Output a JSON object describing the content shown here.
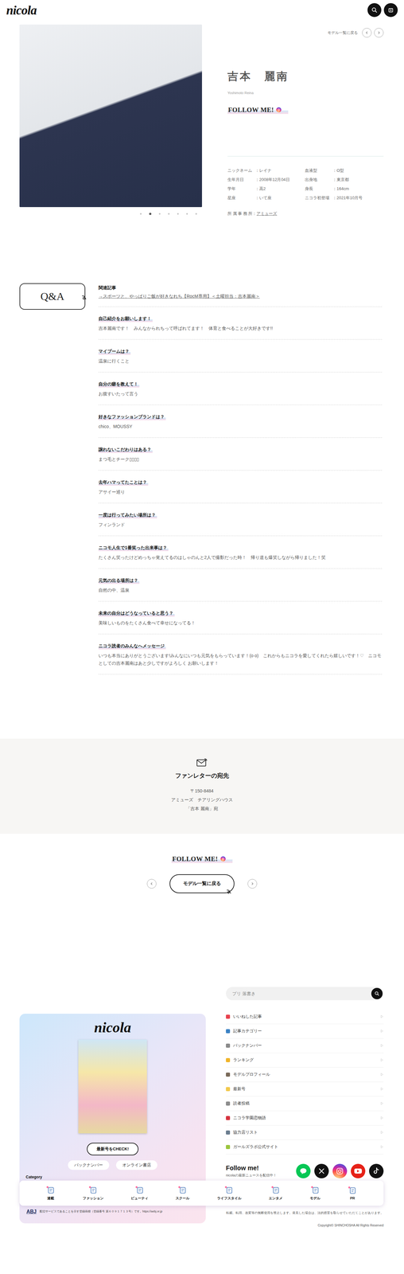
{
  "header": {
    "logo": "nicola"
  },
  "profile": {
    "back": "モデル一覧に戻る",
    "name": "吉本　麗南",
    "romaji": "Yoshimoto Reina",
    "follow": "FOLLOW ME!",
    "info": [
      {
        "label": "ニックネーム",
        "value": "：レイナ"
      },
      {
        "label": "血液型",
        "value": "：O型"
      },
      {
        "label": "生年月日",
        "value": "：2008年12月04日"
      },
      {
        "label": "出身地",
        "value": "：東京都"
      },
      {
        "label": "学年",
        "value": "：高2"
      },
      {
        "label": "身長",
        "value": "：164cm"
      },
      {
        "label": "星座",
        "value": "：いて座"
      },
      {
        "label": "ニコラ初登場",
        "value": "：2021年10月号"
      }
    ],
    "agency_label": "所 属 事 務 所：",
    "agency": "アミューズ"
  },
  "carousel": {
    "dots": [
      {
        "selected": false
      },
      {
        "selected": true
      },
      {
        "selected": false
      },
      {
        "selected": false
      },
      {
        "selected": false
      },
      {
        "selected": false
      },
      {
        "selected": false
      }
    ]
  },
  "qa": {
    "badge": "Q&A",
    "related_label": "関連記事",
    "related_link": "→スポーツと、やっぱりご飯が好きなれち【RocM専用】＜土曜担当：吉本麗南＞",
    "items": [
      {
        "q": "自己紹介をお願いします！",
        "a": "吉本麗南です！　みんなかられちって呼ばれてます！　体育と食べることが大好きです!!"
      },
      {
        "q": "マイブームは？",
        "a": "温泉に行くこと"
      },
      {
        "q": "自分の癖を教えて！",
        "a": "お腹すいたって言う"
      },
      {
        "q": "好きなファッションブランドは？",
        "a": "chico、MOUSSY"
      },
      {
        "q": "譲れないこだわりはある？",
        "a": "まつ毛とチーク▯▯▯▯"
      },
      {
        "q": "去年ハマってたことは？",
        "a": "アサイー巡り"
      },
      {
        "q": "一度は行ってみたい場所は？",
        "a": "フィンランド"
      },
      {
        "q": "ニコモ人生で1番笑った出来事は？",
        "a": "たくさん笑ったけどめっちゃ覚えてるのはしゃのんと2人で撮影だった時！　帰り道も爆笑しながら帰りました！笑"
      },
      {
        "q": "元気の出る場所は？",
        "a": "自然の中、温泉"
      },
      {
        "q": "未来の自分はどうなっていると思う？",
        "a": "美味しいものをたくさん食べて幸せになってる！"
      },
      {
        "q": "ニコラ読者のみんなへメッセージ",
        "a": "いつも本当にありがとうございます!みんなにいつも元気をもらっています！(o o)　これからもニコラを愛してくれたら嬉しいです！♡　ニコモとしての吉本麗南はあと少しですがよろしく お願いします！"
      }
    ]
  },
  "fan_letter": {
    "title": "ファンレターの宛先",
    "zip": "〒150-8484",
    "address": "アミューズ　チアリングハウス",
    "to": "「吉本 麗南」宛"
  },
  "bottom_nav": {
    "follow": "FOLLOW ME!",
    "back": "モデル一覧に戻る"
  },
  "footer": {
    "search_placeholder": "プリ 落書き",
    "menu": [
      {
        "label": "いいねした記事",
        "color": "#e8424e"
      },
      {
        "label": "記事カテゴリー",
        "color": "#3b82c4"
      },
      {
        "label": "バックナンバー",
        "color": "#8a8a8a"
      },
      {
        "label": "ランキング",
        "color": "#f0b429"
      },
      {
        "label": "モデルプロフィール",
        "color": "#7a6a5a"
      },
      {
        "label": "最新号",
        "color": "#f2c94c"
      },
      {
        "label": "読者投稿",
        "color": "#8c8c8c"
      },
      {
        "label": "ニコラ学園恋物語",
        "color": "#d6333f"
      },
      {
        "label": "協力店リスト",
        "color": "#6b7d8f"
      },
      {
        "label": "ガールズラボ公式サイト",
        "color": "#9bc53d"
      }
    ],
    "card": {
      "logo": "nicola",
      "cta": "最新号をCHECK!",
      "links": [
        "バックナンバー",
        "オンライン書店"
      ],
      "abj": "ABJ",
      "abj_text": "配信サービスであることを示す登録商標（登録番号 第６０９１７１３号）です。https://aebj.or.jp"
    },
    "follow_title": "Follow me!",
    "follow_sub": "nicolaの最新ニュースを配信中！",
    "social": [
      {
        "kind": "line",
        "color": "#06c755"
      },
      {
        "kind": "x",
        "color": "#111111"
      },
      {
        "kind": "instagram",
        "color": "#d6249f"
      },
      {
        "kind": "youtube",
        "color": "#e62117"
      },
      {
        "kind": "tiktok",
        "color": "#111111"
      }
    ],
    "notice": "転載、転用、改変等の無断使用を禁止します。発見した場合は、法的措置を取らせていただくことがあります。",
    "copyright": "Copyright© SHINCHOSHA All Rights Reserved"
  },
  "category": {
    "label": "Category",
    "items": [
      "連載",
      "ファッション",
      "ビューティ",
      "スクール",
      "ライフスタイル",
      "エンタメ",
      "モデル",
      "PR"
    ]
  }
}
